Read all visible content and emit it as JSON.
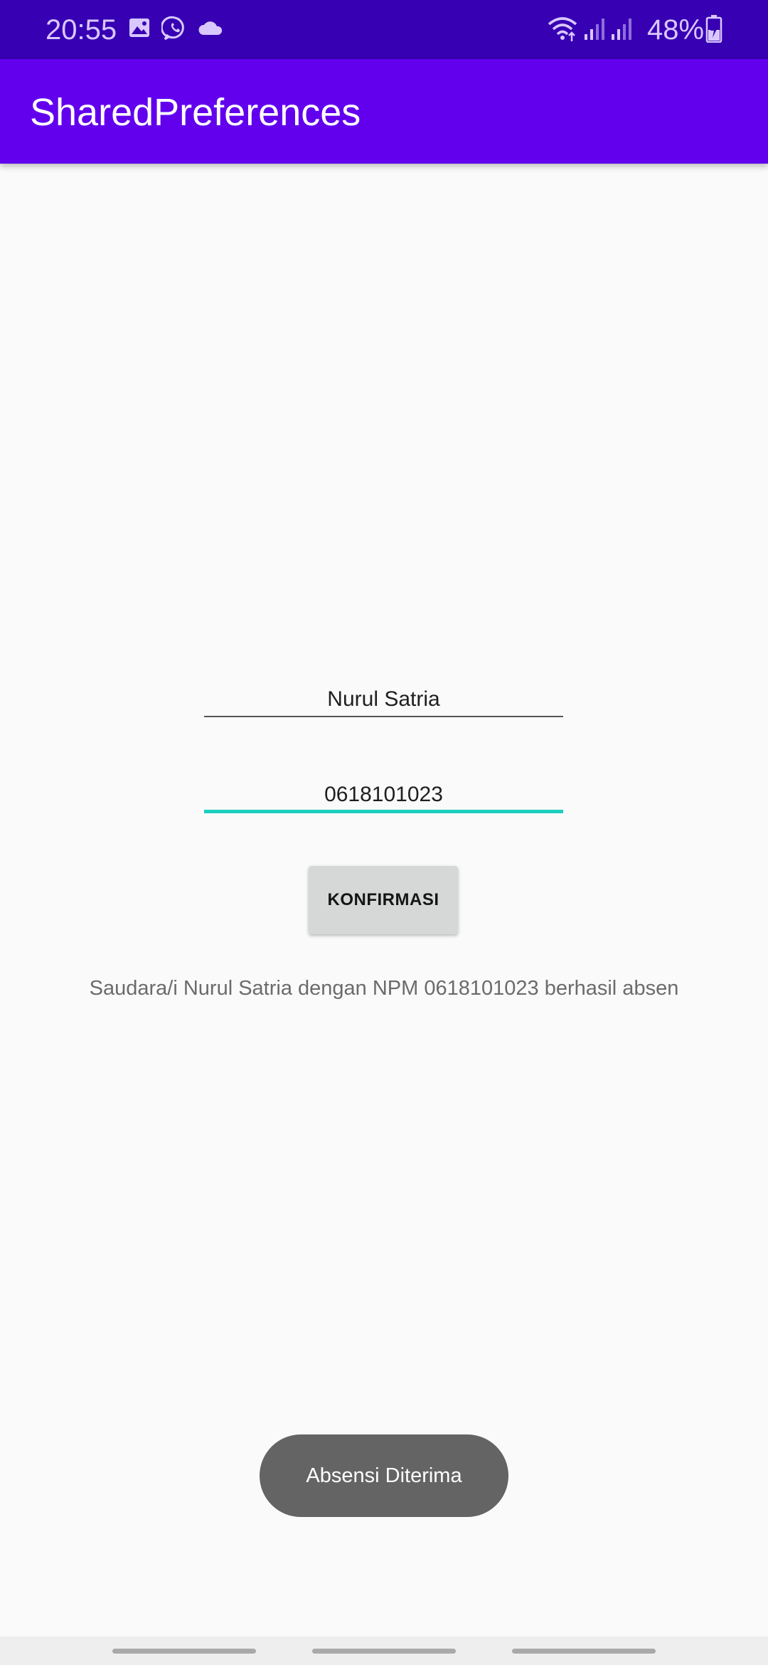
{
  "status_bar": {
    "time": "20:55",
    "battery": "48%",
    "icons": [
      "gallery-icon",
      "whatsapp-icon",
      "cloud-icon",
      "wifi-icon",
      "signal-icon",
      "signal-icon",
      "battery-charging-icon"
    ],
    "background": "#3700b3"
  },
  "app_bar": {
    "title": "SharedPreferences",
    "background": "#6200ee"
  },
  "form": {
    "name_value": "Nurul Satria",
    "npm_value": "0618101023",
    "confirm_label": "KONFIRMASI",
    "focus_color": "#1ccfbe"
  },
  "result": {
    "message": "Saudara/i Nurul Satria dengan NPM 0618101023 berhasil absen"
  },
  "toast": {
    "message": "Absensi Diterima"
  }
}
